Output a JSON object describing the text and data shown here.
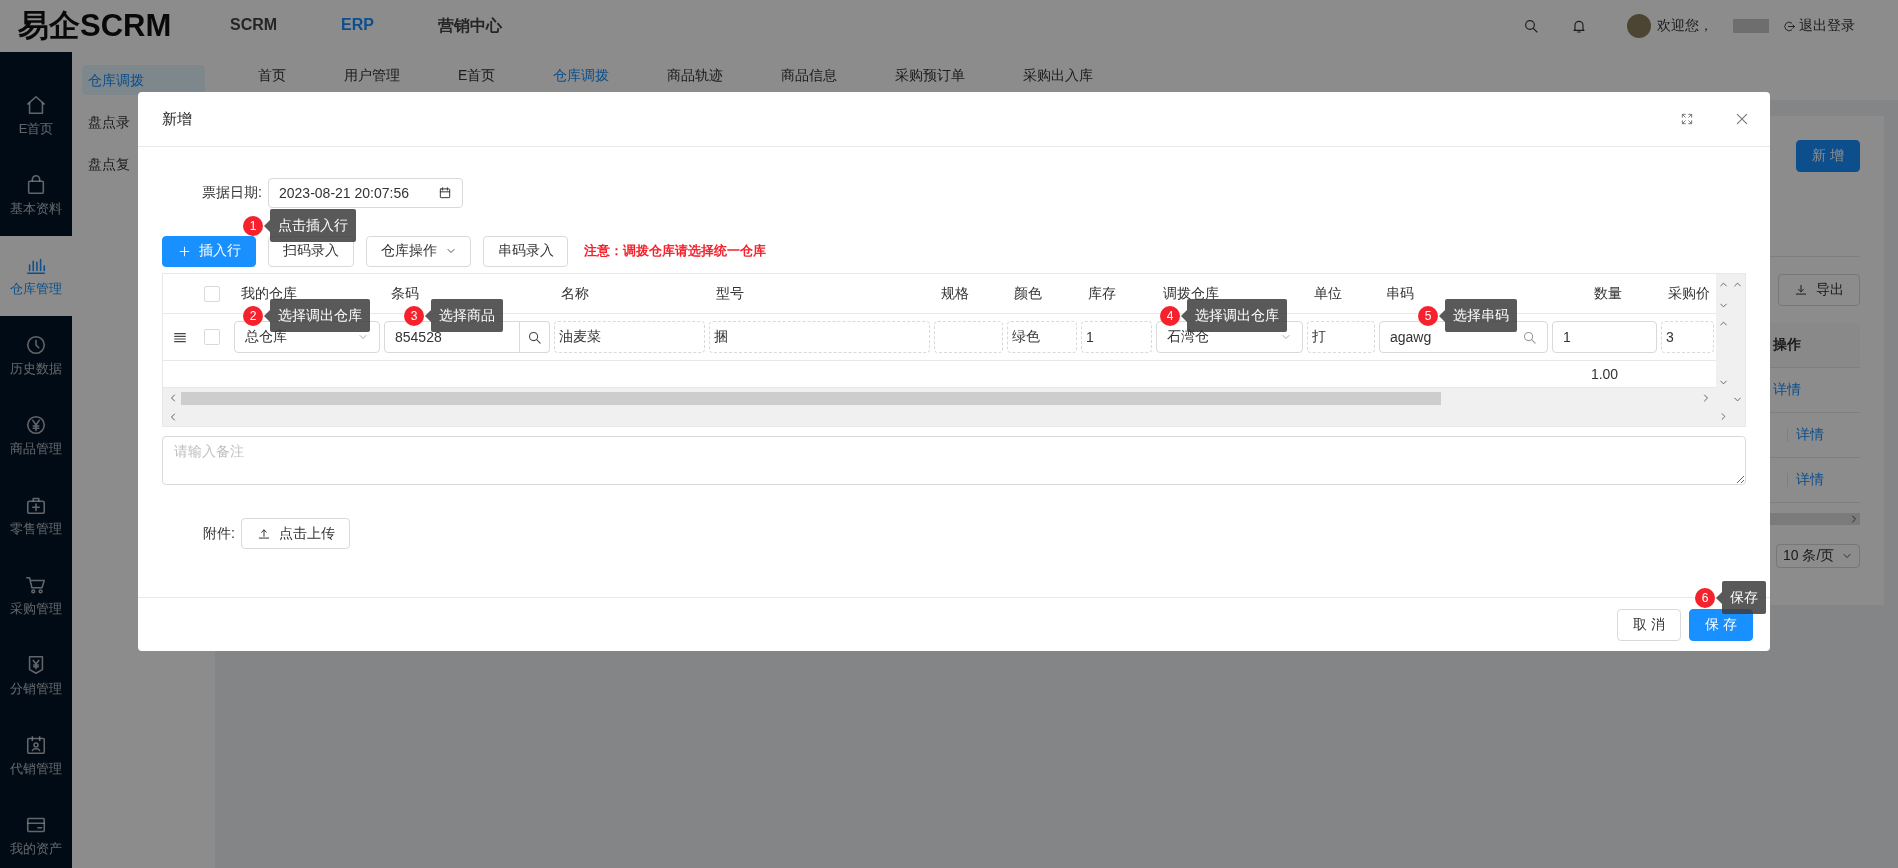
{
  "header": {
    "logo": "易企SCRM",
    "nav": [
      {
        "label": "SCRM",
        "selected": false
      },
      {
        "label": "ERP",
        "selected": true
      },
      {
        "label": "营销中心",
        "selected": false
      }
    ],
    "welcome": "欢迎您，",
    "logout": "退出登录"
  },
  "sidebar": {
    "items": [
      {
        "label": "E首页",
        "selected": false
      },
      {
        "label": "基本资料",
        "selected": false
      },
      {
        "label": "仓库管理",
        "selected": true
      },
      {
        "label": "历史数据",
        "selected": false
      },
      {
        "label": "商品管理",
        "selected": false
      },
      {
        "label": "零售管理",
        "selected": false
      },
      {
        "label": "采购管理",
        "selected": false
      },
      {
        "label": "分销管理",
        "selected": false
      },
      {
        "label": "代销管理",
        "selected": false
      },
      {
        "label": "我的资产",
        "selected": false
      }
    ]
  },
  "submenu": [
    {
      "label": "仓库调拨",
      "selected": true
    },
    {
      "label": "盘点录",
      "selected": false
    },
    {
      "label": "盘点复",
      "selected": false
    }
  ],
  "tabs": [
    {
      "label": "首页",
      "selected": false
    },
    {
      "label": "用户管理",
      "selected": false
    },
    {
      "label": "E首页",
      "selected": false
    },
    {
      "label": "仓库调拨",
      "selected": true
    },
    {
      "label": "商品轨迹",
      "selected": false
    },
    {
      "label": "商品信息",
      "selected": false
    },
    {
      "label": "采购预订单",
      "selected": false
    },
    {
      "label": "采购出入库",
      "selected": false
    }
  ],
  "page": {
    "new_button": "新 增",
    "export_button": "导出",
    "column": "操作",
    "rows": [
      {
        "link": "详情",
        "separator": false
      },
      {
        "link": "详情",
        "separator": true
      },
      {
        "link": "详情",
        "separator": true
      }
    ],
    "page_size": "10 条/页"
  },
  "dialog": {
    "title": "新增",
    "date_label": "票据日期:",
    "date_value": "2023-08-21 20:07:56",
    "toolbar": [
      {
        "label": "插入行",
        "kind": "primary"
      },
      {
        "label": "扫码录入",
        "kind": "default"
      },
      {
        "label": "仓库操作",
        "kind": "dropdown"
      },
      {
        "label": "串码录入",
        "kind": "default"
      }
    ],
    "notice": "注意：调拨仓库请选择统一仓库",
    "table": {
      "all_checked": false,
      "columns": [
        {
          "label": "我的仓库"
        },
        {
          "label": "条码"
        },
        {
          "label": "名称"
        },
        {
          "label": "型号"
        },
        {
          "label": "规格"
        },
        {
          "label": "颜色"
        },
        {
          "label": "库存"
        },
        {
          "label": "调拨仓库"
        },
        {
          "label": "单位"
        },
        {
          "label": "串码"
        },
        {
          "label": "数量",
          "total": "1.00"
        },
        {
          "label": "采购价"
        }
      ],
      "rows": [
        {
          "checked": false,
          "cells": [
            {
              "kind": "select",
              "value": "总仓库"
            },
            {
              "kind": "search",
              "value": "854528"
            },
            {
              "kind": "text",
              "value": "油麦菜"
            },
            {
              "kind": "text",
              "value": "捆"
            },
            {
              "kind": "text"
            },
            {
              "kind": "text",
              "value": "绿色"
            },
            {
              "kind": "text",
              "value": "1"
            },
            {
              "kind": "select",
              "value": "石湾仓"
            },
            {
              "kind": "text",
              "value": "打"
            },
            {
              "kind": "search_inline",
              "value": "agawg"
            },
            {
              "kind": "input",
              "value": "1"
            },
            {
              "kind": "text",
              "value": "3"
            }
          ]
        }
      ]
    },
    "remark_placeholder": "请输入备注",
    "attachment_label": "附件:",
    "upload_button": "点击上传",
    "buttons": [
      {
        "label": "取 消",
        "kind": "default"
      },
      {
        "label": "保 存",
        "kind": "primary"
      }
    ]
  },
  "guides": [
    {
      "number": "1",
      "text": "点击插入行"
    },
    {
      "number": "2",
      "text": "选择调出仓库"
    },
    {
      "number": "3",
      "text": "选择商品"
    },
    {
      "number": "4",
      "text": "选择调出仓库"
    },
    {
      "number": "5",
      "text": "选择串码"
    },
    {
      "number": "6",
      "text": "保存"
    }
  ]
}
